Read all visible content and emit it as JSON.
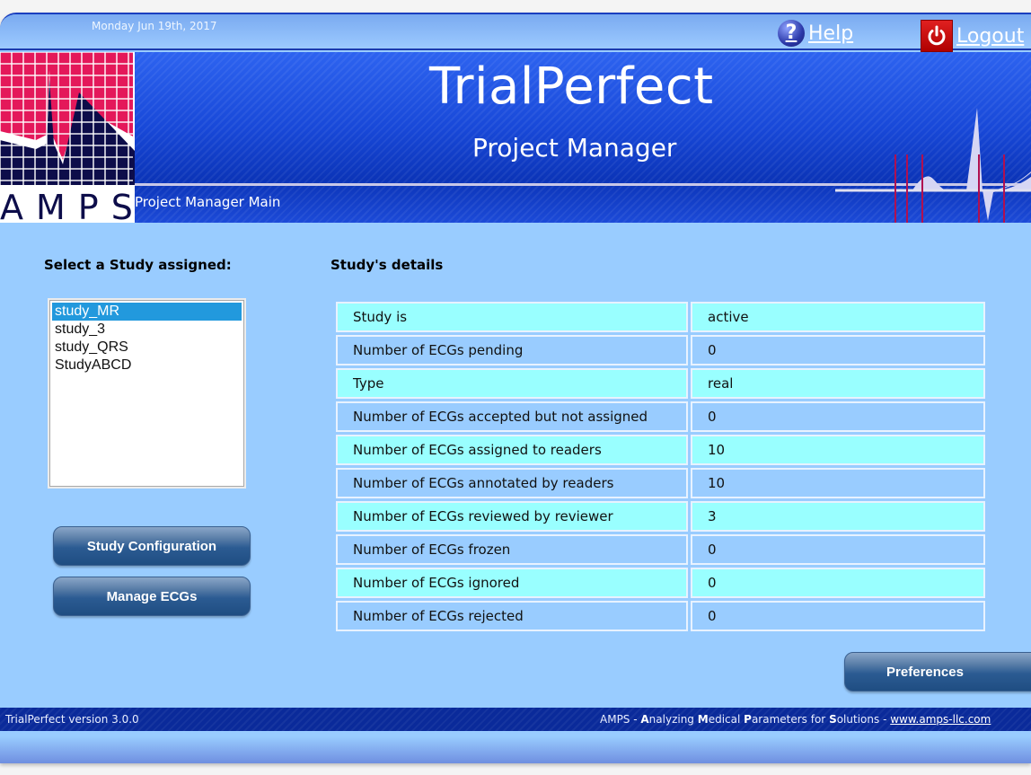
{
  "topbar": {
    "date": "Monday Jun 19th, 2017",
    "help_label": "Help",
    "logout_label": "Logout"
  },
  "banner": {
    "logo_text": "AMPS",
    "title": "TrialPerfect",
    "subtitle": "Project Manager",
    "breadcrumb": "Project Manager Main"
  },
  "left_panel": {
    "heading": "Select a Study assigned:",
    "studies": [
      "study_MR",
      "study_3",
      "study_QRS",
      "StudyABCD"
    ],
    "selected_study": "study_MR",
    "buttons": {
      "study_configuration": "Study Configuration",
      "manage_ecgs": "Manage ECGs"
    }
  },
  "details": {
    "heading": "Study's details",
    "rows": [
      {
        "label": "Study is",
        "value": "active"
      },
      {
        "label": "Number of ECGs pending",
        "value": "0"
      },
      {
        "label": "Type",
        "value": "real"
      },
      {
        "label": "Number of ECGs accepted but not assigned",
        "value": "0"
      },
      {
        "label": "Number of ECGs assigned to readers",
        "value": "10"
      },
      {
        "label": "Number of ECGs annotated by readers",
        "value": "10"
      },
      {
        "label": "Number of ECGs reviewed by reviewer",
        "value": "3"
      },
      {
        "label": "Number of ECGs frozen",
        "value": "0"
      },
      {
        "label": "Number of ECGs ignored",
        "value": "0"
      },
      {
        "label": "Number of ECGs rejected",
        "value": "0"
      }
    ],
    "preferences_label": "Preferences"
  },
  "footer": {
    "version": "TrialPerfect version 3.0.0",
    "credits_prefix": "AMPS - ",
    "credits_words": [
      {
        "initial": "A",
        "rest": "nalyzing "
      },
      {
        "initial": "M",
        "rest": "edical "
      },
      {
        "initial": "P",
        "rest": "arameters for "
      },
      {
        "initial": "S",
        "rest": "olutions"
      }
    ],
    "credits_sep": " - ",
    "link": "www.amps-llc.com"
  },
  "colors": {
    "row_cyan": "#99ffff",
    "row_blue": "#99ccff",
    "banner_blue": "#1848d8",
    "footer_navy": "#0a2a9a",
    "selection": "#2299dd"
  }
}
